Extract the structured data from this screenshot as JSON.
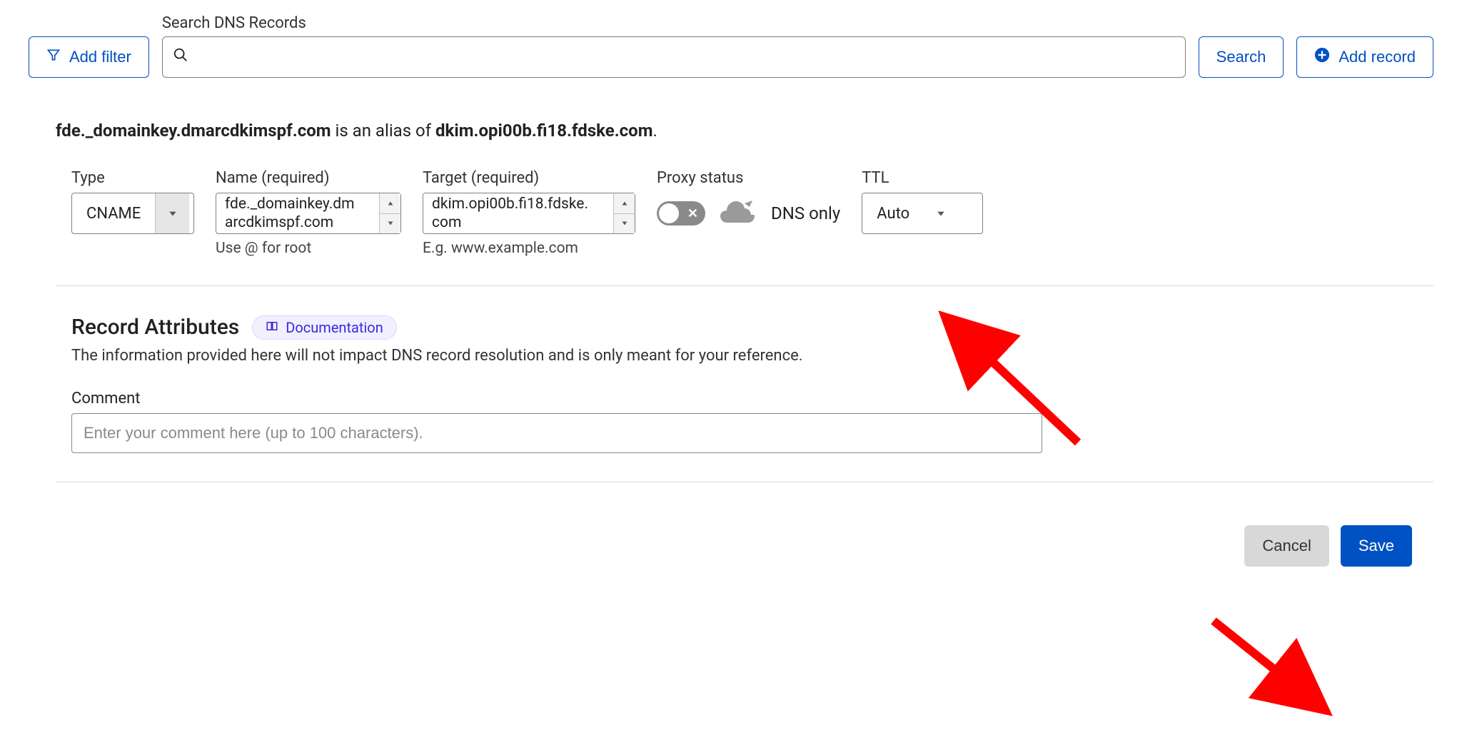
{
  "topbar": {
    "add_filter_label": "Add filter",
    "search_label": "Search DNS Records",
    "search_value": "",
    "search_button_label": "Search",
    "add_record_label": "Add record"
  },
  "summary": {
    "hostname": "fde._domainkey.dmarcdkimspf.com",
    "middle": " is an alias of ",
    "target": "dkim.opi00b.fi18.fdske.com",
    "suffix": "."
  },
  "fields": {
    "type": {
      "label": "Type",
      "value": "CNAME"
    },
    "name": {
      "label": "Name (required)",
      "value_line1": "fde._domainkey.dm",
      "value_line2": "arcdkimspf.com",
      "hint": "Use @ for root"
    },
    "target": {
      "label": "Target (required)",
      "value_line1": "dkim.opi00b.fi18.fdske.",
      "value_line2": "com",
      "hint": "E.g. www.example.com"
    },
    "proxy": {
      "label": "Proxy status",
      "status_text": "DNS only",
      "enabled": false
    },
    "ttl": {
      "label": "TTL",
      "value": "Auto"
    }
  },
  "attributes": {
    "heading": "Record Attributes",
    "doc_label": "Documentation",
    "description": "The information provided here will not impact DNS record resolution and is only meant for your reference.",
    "comment_label": "Comment",
    "comment_placeholder": "Enter your comment here (up to 100 characters).",
    "comment_value": ""
  },
  "footer": {
    "cancel_label": "Cancel",
    "save_label": "Save"
  }
}
